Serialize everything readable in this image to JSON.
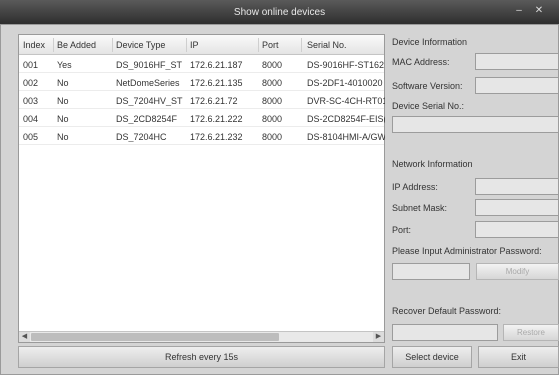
{
  "window": {
    "title": "Show online devices"
  },
  "table": {
    "columns": [
      "Index",
      "Be Added",
      "Device Type",
      "IP",
      "Port",
      "Serial No."
    ],
    "rows": [
      [
        "001",
        "Yes",
        "DS_9016HF_ST",
        "172.6.21.187",
        "8000",
        "DS-9016HF-ST162"
      ],
      [
        "002",
        "No",
        "NetDomeSeries",
        "172.6.21.135",
        "8000",
        "DS-2DF1-4010020"
      ],
      [
        "003",
        "No",
        "DS_7204HV_ST",
        "172.6.21.72",
        "8000",
        "DVR-SC-4CH-RT01"
      ],
      [
        "004",
        "No",
        "DS_2CD8254F",
        "172.6.21.222",
        "8000",
        "DS-2CD8254F-EIS("
      ],
      [
        "005",
        "No",
        "DS_7204HC",
        "172.6.21.232",
        "8000",
        "DS-8104HMI-A/GW("
      ]
    ]
  },
  "device_info": {
    "heading": "Device Information",
    "mac_label": "MAC Address:",
    "software_label": "Software Version:",
    "serial_label": "Device Serial No.:"
  },
  "network_info": {
    "heading": "Network Information",
    "ip_label": "IP Address:",
    "subnet_label": "Subnet Mask:",
    "port_label": "Port:",
    "password_prompt": "Please Input Administrator Password:",
    "modify_button": "Modify",
    "recover_label": "Recover Default Password:",
    "restore_button": "Restore"
  },
  "footer": {
    "refresh_button": "Refresh every 15s",
    "select_button": "Select device",
    "exit_button": "Exit"
  },
  "icons": {
    "minimize": "minimize-icon",
    "close": "close-icon",
    "scroll_left": "arrow-left-icon",
    "scroll_right": "arrow-right-icon"
  }
}
